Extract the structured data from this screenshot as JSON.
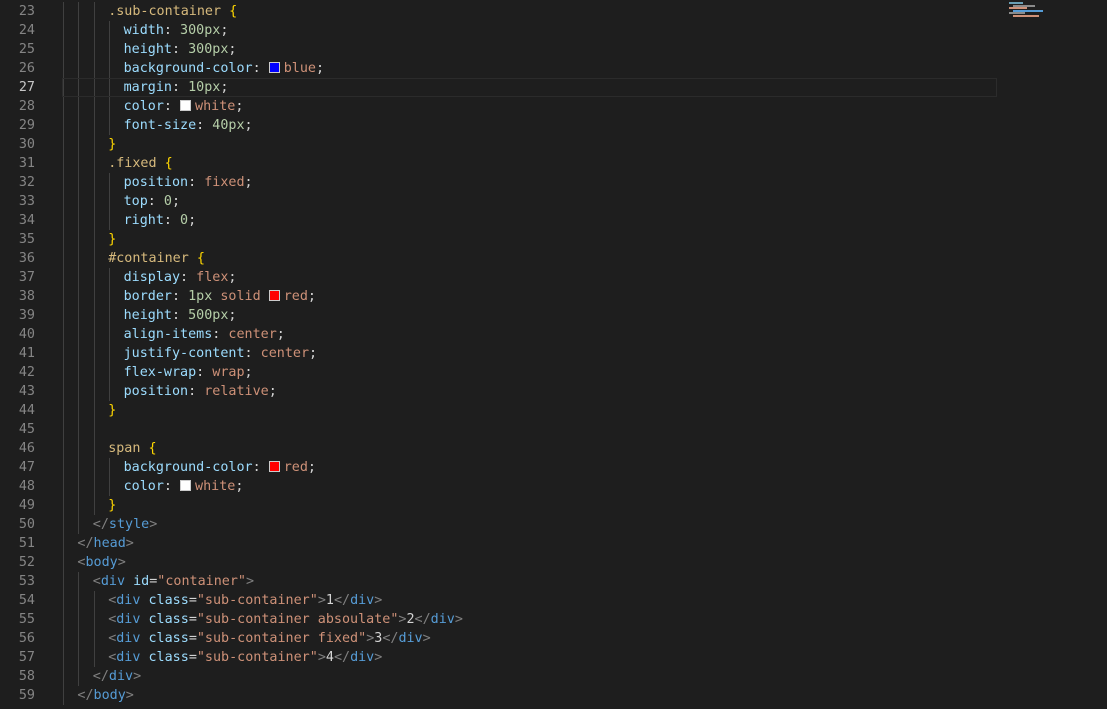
{
  "editor": {
    "active_line": "27",
    "lines": [
      {
        "no": "23",
        "indent": 3,
        "tokens": [
          {
            "t": ".sub-container",
            "c": "sel"
          },
          {
            "t": " ",
            "c": "plain"
          },
          {
            "t": "{",
            "c": "brace"
          }
        ]
      },
      {
        "no": "24",
        "indent": 4,
        "tokens": [
          {
            "t": "width",
            "c": "prop"
          },
          {
            "t": ": ",
            "c": "punct"
          },
          {
            "t": "300px",
            "c": "num"
          },
          {
            "t": ";",
            "c": "punct"
          }
        ]
      },
      {
        "no": "25",
        "indent": 4,
        "tokens": [
          {
            "t": "height",
            "c": "prop"
          },
          {
            "t": ": ",
            "c": "punct"
          },
          {
            "t": "300px",
            "c": "num"
          },
          {
            "t": ";",
            "c": "punct"
          }
        ]
      },
      {
        "no": "26",
        "indent": 4,
        "tokens": [
          {
            "t": "background-color",
            "c": "prop"
          },
          {
            "t": ": ",
            "c": "punct"
          },
          {
            "swatch": "#0000ff"
          },
          {
            "t": "blue",
            "c": "val"
          },
          {
            "t": ";",
            "c": "punct"
          }
        ]
      },
      {
        "no": "27",
        "indent": 4,
        "current": true,
        "tokens": [
          {
            "t": "margin",
            "c": "prop"
          },
          {
            "t": ": ",
            "c": "punct"
          },
          {
            "t": "10px",
            "c": "num"
          },
          {
            "t": ";",
            "c": "punct"
          }
        ]
      },
      {
        "no": "28",
        "indent": 4,
        "tokens": [
          {
            "t": "color",
            "c": "prop"
          },
          {
            "t": ": ",
            "c": "punct"
          },
          {
            "swatch": "#ffffff"
          },
          {
            "t": "white",
            "c": "val"
          },
          {
            "t": ";",
            "c": "punct"
          }
        ]
      },
      {
        "no": "29",
        "indent": 4,
        "tokens": [
          {
            "t": "font-size",
            "c": "prop"
          },
          {
            "t": ": ",
            "c": "punct"
          },
          {
            "t": "40px",
            "c": "num"
          },
          {
            "t": ";",
            "c": "punct"
          }
        ]
      },
      {
        "no": "30",
        "indent": 3,
        "tokens": [
          {
            "t": "}",
            "c": "brace"
          }
        ]
      },
      {
        "no": "31",
        "indent": 3,
        "tokens": [
          {
            "t": ".fixed",
            "c": "sel"
          },
          {
            "t": " ",
            "c": "plain"
          },
          {
            "t": "{",
            "c": "brace"
          }
        ]
      },
      {
        "no": "32",
        "indent": 4,
        "tokens": [
          {
            "t": "position",
            "c": "prop"
          },
          {
            "t": ": ",
            "c": "punct"
          },
          {
            "t": "fixed",
            "c": "val"
          },
          {
            "t": ";",
            "c": "punct"
          }
        ]
      },
      {
        "no": "33",
        "indent": 4,
        "tokens": [
          {
            "t": "top",
            "c": "prop"
          },
          {
            "t": ": ",
            "c": "punct"
          },
          {
            "t": "0",
            "c": "num"
          },
          {
            "t": ";",
            "c": "punct"
          }
        ]
      },
      {
        "no": "34",
        "indent": 4,
        "tokens": [
          {
            "t": "right",
            "c": "prop"
          },
          {
            "t": ": ",
            "c": "punct"
          },
          {
            "t": "0",
            "c": "num"
          },
          {
            "t": ";",
            "c": "punct"
          }
        ]
      },
      {
        "no": "35",
        "indent": 3,
        "tokens": [
          {
            "t": "}",
            "c": "brace"
          }
        ]
      },
      {
        "no": "36",
        "indent": 3,
        "tokens": [
          {
            "t": "#container",
            "c": "sel"
          },
          {
            "t": " ",
            "c": "plain"
          },
          {
            "t": "{",
            "c": "brace"
          }
        ]
      },
      {
        "no": "37",
        "indent": 4,
        "tokens": [
          {
            "t": "display",
            "c": "prop"
          },
          {
            "t": ": ",
            "c": "punct"
          },
          {
            "t": "flex",
            "c": "val"
          },
          {
            "t": ";",
            "c": "punct"
          }
        ]
      },
      {
        "no": "38",
        "indent": 4,
        "tokens": [
          {
            "t": "border",
            "c": "prop"
          },
          {
            "t": ": ",
            "c": "punct"
          },
          {
            "t": "1px",
            "c": "num"
          },
          {
            "t": " solid ",
            "c": "val"
          },
          {
            "swatch": "#ff0000"
          },
          {
            "t": "red",
            "c": "val"
          },
          {
            "t": ";",
            "c": "punct"
          }
        ]
      },
      {
        "no": "39",
        "indent": 4,
        "tokens": [
          {
            "t": "height",
            "c": "prop"
          },
          {
            "t": ": ",
            "c": "punct"
          },
          {
            "t": "500px",
            "c": "num"
          },
          {
            "t": ";",
            "c": "punct"
          }
        ]
      },
      {
        "no": "40",
        "indent": 4,
        "tokens": [
          {
            "t": "align-items",
            "c": "prop"
          },
          {
            "t": ": ",
            "c": "punct"
          },
          {
            "t": "center",
            "c": "val"
          },
          {
            "t": ";",
            "c": "punct"
          }
        ]
      },
      {
        "no": "41",
        "indent": 4,
        "tokens": [
          {
            "t": "justify-content",
            "c": "prop"
          },
          {
            "t": ": ",
            "c": "punct"
          },
          {
            "t": "center",
            "c": "val"
          },
          {
            "t": ";",
            "c": "punct"
          }
        ]
      },
      {
        "no": "42",
        "indent": 4,
        "tokens": [
          {
            "t": "flex-wrap",
            "c": "prop"
          },
          {
            "t": ": ",
            "c": "punct"
          },
          {
            "t": "wrap",
            "c": "val"
          },
          {
            "t": ";",
            "c": "punct"
          }
        ]
      },
      {
        "no": "43",
        "indent": 4,
        "tokens": [
          {
            "t": "position",
            "c": "prop"
          },
          {
            "t": ": ",
            "c": "punct"
          },
          {
            "t": "relative",
            "c": "val"
          },
          {
            "t": ";",
            "c": "punct"
          }
        ]
      },
      {
        "no": "44",
        "indent": 3,
        "tokens": [
          {
            "t": "}",
            "c": "brace"
          }
        ]
      },
      {
        "no": "45",
        "indent": 3,
        "tokens": []
      },
      {
        "no": "46",
        "indent": 3,
        "tokens": [
          {
            "t": "span",
            "c": "sel"
          },
          {
            "t": " ",
            "c": "plain"
          },
          {
            "t": "{",
            "c": "brace"
          }
        ]
      },
      {
        "no": "47",
        "indent": 4,
        "tokens": [
          {
            "t": "background-color",
            "c": "prop"
          },
          {
            "t": ": ",
            "c": "punct"
          },
          {
            "swatch": "#ff0000"
          },
          {
            "t": "red",
            "c": "val"
          },
          {
            "t": ";",
            "c": "punct"
          }
        ]
      },
      {
        "no": "48",
        "indent": 4,
        "tokens": [
          {
            "t": "color",
            "c": "prop"
          },
          {
            "t": ": ",
            "c": "punct"
          },
          {
            "swatch": "#ffffff"
          },
          {
            "t": "white",
            "c": "val"
          },
          {
            "t": ";",
            "c": "punct"
          }
        ]
      },
      {
        "no": "49",
        "indent": 3,
        "tokens": [
          {
            "t": "}",
            "c": "brace"
          }
        ]
      },
      {
        "no": "50",
        "indent": 2,
        "tokens": [
          {
            "t": "</",
            "c": "angle"
          },
          {
            "t": "style",
            "c": "tag"
          },
          {
            "t": ">",
            "c": "angle"
          }
        ]
      },
      {
        "no": "51",
        "indent": 1,
        "tokens": [
          {
            "t": "</",
            "c": "angle"
          },
          {
            "t": "head",
            "c": "tag"
          },
          {
            "t": ">",
            "c": "angle"
          }
        ]
      },
      {
        "no": "52",
        "indent": 1,
        "tokens": [
          {
            "t": "<",
            "c": "angle"
          },
          {
            "t": "body",
            "c": "tag"
          },
          {
            "t": ">",
            "c": "angle"
          }
        ]
      },
      {
        "no": "53",
        "indent": 2,
        "tokens": [
          {
            "t": "<",
            "c": "angle"
          },
          {
            "t": "div",
            "c": "tag"
          },
          {
            "t": " ",
            "c": "plain"
          },
          {
            "t": "id",
            "c": "attr"
          },
          {
            "t": "=",
            "c": "punct"
          },
          {
            "t": "\"container\"",
            "c": "str"
          },
          {
            "t": ">",
            "c": "angle"
          }
        ]
      },
      {
        "no": "54",
        "indent": 3,
        "tokens": [
          {
            "t": "<",
            "c": "angle"
          },
          {
            "t": "div",
            "c": "tag"
          },
          {
            "t": " ",
            "c": "plain"
          },
          {
            "t": "class",
            "c": "attr"
          },
          {
            "t": "=",
            "c": "punct"
          },
          {
            "t": "\"sub-container\"",
            "c": "str"
          },
          {
            "t": ">",
            "c": "angle"
          },
          {
            "t": "1",
            "c": "plain"
          },
          {
            "t": "</",
            "c": "angle"
          },
          {
            "t": "div",
            "c": "tag"
          },
          {
            "t": ">",
            "c": "angle"
          }
        ]
      },
      {
        "no": "55",
        "indent": 3,
        "tokens": [
          {
            "t": "<",
            "c": "angle"
          },
          {
            "t": "div",
            "c": "tag"
          },
          {
            "t": " ",
            "c": "plain"
          },
          {
            "t": "class",
            "c": "attr"
          },
          {
            "t": "=",
            "c": "punct"
          },
          {
            "t": "\"sub-container absoulate\"",
            "c": "str"
          },
          {
            "t": ">",
            "c": "angle"
          },
          {
            "t": "2",
            "c": "plain"
          },
          {
            "t": "</",
            "c": "angle"
          },
          {
            "t": "div",
            "c": "tag"
          },
          {
            "t": ">",
            "c": "angle"
          }
        ]
      },
      {
        "no": "56",
        "indent": 3,
        "tokens": [
          {
            "t": "<",
            "c": "angle"
          },
          {
            "t": "div",
            "c": "tag"
          },
          {
            "t": " ",
            "c": "plain"
          },
          {
            "t": "class",
            "c": "attr"
          },
          {
            "t": "=",
            "c": "punct"
          },
          {
            "t": "\"sub-container fixed\"",
            "c": "str"
          },
          {
            "t": ">",
            "c": "angle"
          },
          {
            "t": "3",
            "c": "plain"
          },
          {
            "t": "</",
            "c": "angle"
          },
          {
            "t": "div",
            "c": "tag"
          },
          {
            "t": ">",
            "c": "angle"
          }
        ]
      },
      {
        "no": "57",
        "indent": 3,
        "tokens": [
          {
            "t": "<",
            "c": "angle"
          },
          {
            "t": "div",
            "c": "tag"
          },
          {
            "t": " ",
            "c": "plain"
          },
          {
            "t": "class",
            "c": "attr"
          },
          {
            "t": "=",
            "c": "punct"
          },
          {
            "t": "\"sub-container\"",
            "c": "str"
          },
          {
            "t": ">",
            "c": "angle"
          },
          {
            "t": "4",
            "c": "plain"
          },
          {
            "t": "</",
            "c": "angle"
          },
          {
            "t": "div",
            "c": "tag"
          },
          {
            "t": ">",
            "c": "angle"
          }
        ]
      },
      {
        "no": "58",
        "indent": 2,
        "tokens": [
          {
            "t": "</",
            "c": "angle"
          },
          {
            "t": "div",
            "c": "tag"
          },
          {
            "t": ">",
            "c": "angle"
          }
        ]
      },
      {
        "no": "59",
        "indent": 1,
        "tokens": [
          {
            "t": "</",
            "c": "angle"
          },
          {
            "t": "body",
            "c": "tag"
          },
          {
            "t": ">",
            "c": "angle"
          }
        ]
      }
    ]
  }
}
